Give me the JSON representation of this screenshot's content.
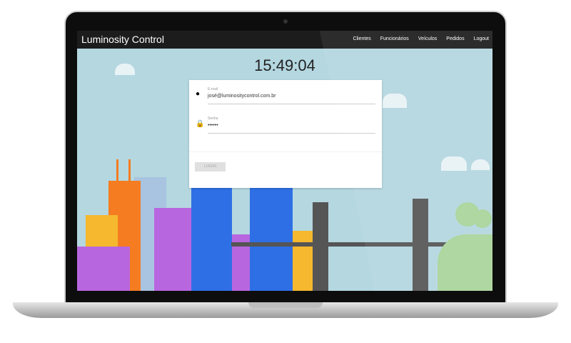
{
  "app": {
    "title": "Luminosity Control"
  },
  "nav": {
    "items": [
      "Clientes",
      "Funcionários",
      "Veículos",
      "Pedidos",
      "Logout"
    ]
  },
  "clock": "15:49:04",
  "login": {
    "email_label": "E-mail",
    "email_value": "josé@luminositycontrol.com.br",
    "password_label": "Senha",
    "password_value": "••••••",
    "login_button": "LOGIN"
  },
  "icons": {
    "user": "account-circle-icon",
    "lock": "lock-icon"
  }
}
